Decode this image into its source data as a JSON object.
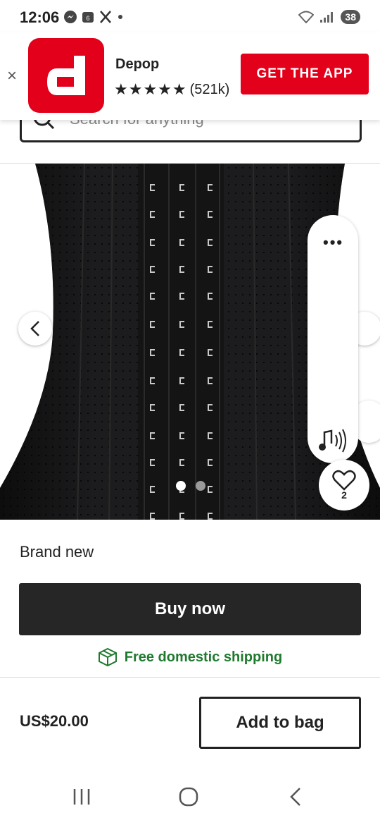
{
  "status_bar": {
    "time": "12:06",
    "battery": "38",
    "icons": [
      "messenger-icon",
      "calendar-icon",
      "x-icon",
      "dot-icon",
      "wifi-icon",
      "signal-icon"
    ]
  },
  "app_banner": {
    "app_name": "Depop",
    "stars": "★★★★★",
    "rating_count": "(521k)",
    "cta_label": "GET THE APP",
    "close_label": "×",
    "logo_letter": "d",
    "brand_color": "#e2001a"
  },
  "search": {
    "placeholder": "Search for anything"
  },
  "gallery": {
    "total_images": 2,
    "current_index": 1,
    "more_label": "•••"
  },
  "like": {
    "count": "2"
  },
  "product": {
    "condition": "Brand new",
    "price": "US$20.00"
  },
  "actions": {
    "buy_now": "Buy now",
    "add_to_bag": "Add to bag",
    "shipping": "Free domestic shipping",
    "shipping_color": "#1f7a2e"
  },
  "nav": {
    "items": [
      "recents-icon",
      "home-icon",
      "back-icon"
    ]
  }
}
